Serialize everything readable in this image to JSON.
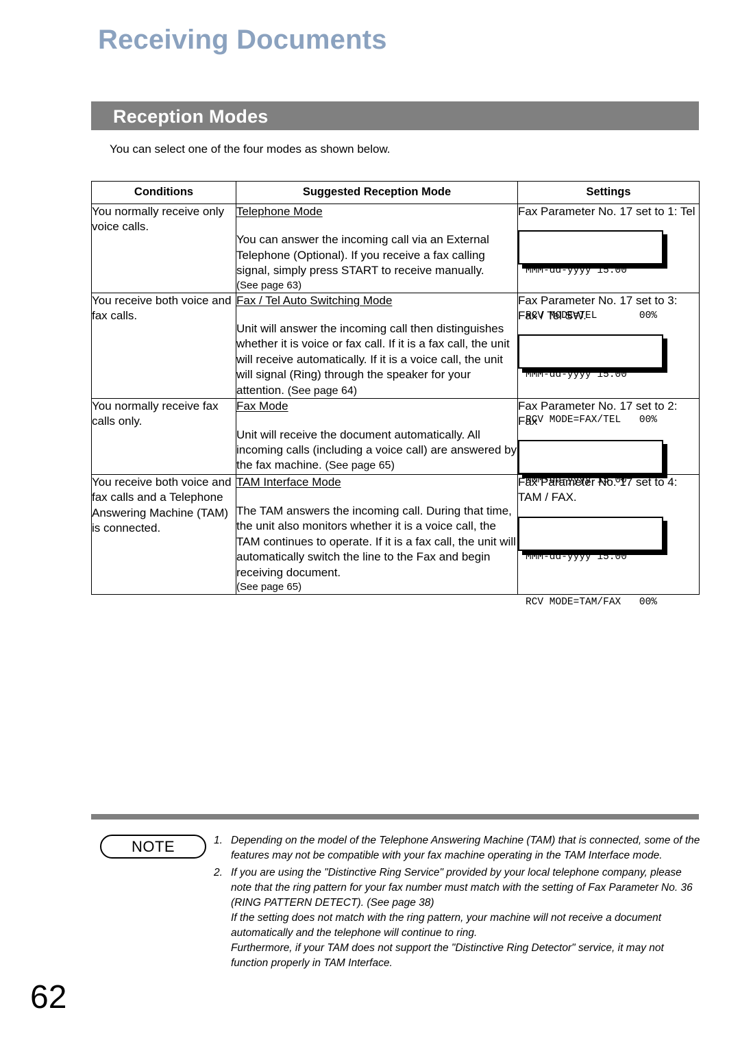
{
  "page": {
    "title": "Receiving Documents",
    "number": "62"
  },
  "section": {
    "banner_label": "Reception Modes",
    "intro": "You can select one of the four modes as shown below."
  },
  "table": {
    "headers": {
      "conditions": "Conditions",
      "mode": "Suggested Reception Mode",
      "settings": "Settings"
    },
    "rows": [
      {
        "conditions": "You normally receive only voice calls.",
        "mode_name": "Telephone Mode",
        "mode_desc": "You can answer the incoming call via an External Telephone (Optional). If you receive a fax calling signal, simply press START to receive manually.",
        "mode_seepage": "(See page 63)",
        "settings_text": "Fax Parameter No. 17 set to 1: Tel",
        "lcd": {
          "line1_left": "MMM-dd-yyyy 15:00",
          "line1_right": "",
          "line2_left": "RCV MODE=TEL",
          "line2_right": "00%"
        }
      },
      {
        "conditions": "You receive both voice and fax calls.",
        "mode_name": "Fax / Tel Auto Switching Mode",
        "mode_desc": "Unit will answer the incoming call then distinguishes whether it is voice or fax call. If it is a fax call, the unit will receive automatically. If it is a voice call, the unit will signal (Ring) through the speaker for your attention.",
        "mode_seepage": "(See page 64)",
        "settings_text": "Fax Parameter No. 17 set to 3: Fax / Tel SW.",
        "lcd": {
          "line1_left": "MMM-dd-yyyy 15:00",
          "line1_right": "",
          "line2_left": "RCV MODE=FAX/TEL",
          "line2_right": "00%"
        }
      },
      {
        "conditions": "You normally receive fax calls only.",
        "mode_name": "Fax Mode",
        "mode_desc": "Unit will receive the document automatically. All incoming calls (including a voice call) are answered by the fax machine.",
        "mode_seepage": "(See page 65)",
        "settings_text": "Fax Parameter No. 17 set to 2: Fax",
        "lcd": {
          "line1_left": "MMM-dd-yyyy 15:00",
          "line1_right": "",
          "line2_left": "",
          "line2_right": "00%"
        }
      },
      {
        "conditions": "You receive both voice and fax calls and a Telephone Answering Machine (TAM) is connected.",
        "mode_name": "TAM Interface Mode",
        "mode_desc": "The TAM answers the incoming call. During that time, the unit also monitors whether it is a voice call, the TAM continues to operate. If it is a fax call, the unit will automatically switch the line to the Fax and begin receiving document.",
        "mode_seepage": "(See page 65)",
        "settings_text": "Fax Parameter No. 17 set to 4: TAM / FAX.",
        "lcd": {
          "line1_left": "MMM-dd-yyyy 15:00",
          "line1_right": "",
          "line2_left": "RCV MODE=TAM/FAX",
          "line2_right": "00%"
        }
      }
    ]
  },
  "note": {
    "badge_label": "NOTE",
    "items": [
      {
        "number": "1.",
        "text": "Depending on the model of the Telephone Answering Machine (TAM) that is connected, some of the features may not be compatible with your fax machine operating in the TAM Interface mode.",
        "extra": []
      },
      {
        "number": "2.",
        "text": "If you are using the \"Distinctive Ring Service\" provided by your local telephone company, please note that the ring pattern for your fax number must match with the setting of Fax Parameter No. 36 (RING PATTERN DETECT).  (See page 38)",
        "extra": [
          "If the setting does not match with the ring pattern, your machine will not receive a document automatically and the telephone will continue to ring.",
          "Furthermore, if your TAM does not support the \"Distinctive Ring Detector\" service, it may not function properly in TAM Interface."
        ]
      }
    ]
  },
  "colors": {
    "title": "#8ba2bf",
    "banner": "#808080",
    "rule": "#808080",
    "text": "#000000"
  }
}
